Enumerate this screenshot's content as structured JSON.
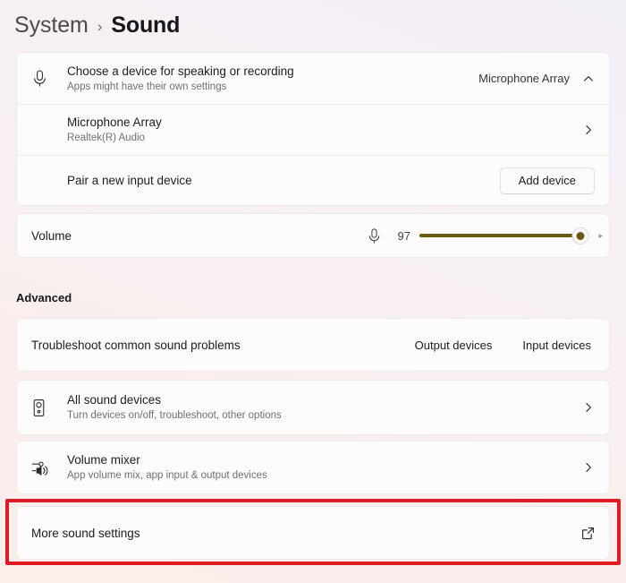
{
  "breadcrumb": {
    "parent": "System",
    "separator": "›",
    "current": "Sound"
  },
  "input_device_card": {
    "chooser": {
      "icon": "microphone-icon",
      "title": "Choose a device for speaking or recording",
      "subtitle": "Apps might have their own settings",
      "selected_device": "Microphone Array",
      "expand_icon": "chevron-up-icon"
    },
    "device": {
      "title": "Microphone Array",
      "subtitle": "Realtek(R) Audio",
      "chevron_icon": "chevron-right-icon"
    },
    "pair": {
      "title": "Pair a new input device",
      "button_label": "Add device"
    }
  },
  "volume_card": {
    "label": "Volume",
    "icon": "microphone-icon",
    "value": "97",
    "percent": 97,
    "accent_color": "#6b5a14"
  },
  "advanced": {
    "heading": "Advanced",
    "troubleshoot": {
      "title": "Troubleshoot common sound problems",
      "links": [
        "Output devices",
        "Input devices"
      ]
    },
    "all_sound_devices": {
      "icon": "speaker-device-icon",
      "title": "All sound devices",
      "subtitle": "Turn devices on/off, troubleshoot, other options",
      "chevron_icon": "chevron-right-icon"
    },
    "volume_mixer": {
      "icon": "volume-mixer-icon",
      "title": "Volume mixer",
      "subtitle": "App volume mix, app input & output devices",
      "chevron_icon": "chevron-right-icon"
    },
    "more_sound_settings": {
      "title": "More sound settings",
      "icon": "external-link-icon",
      "highlight_color": "#e01b23"
    }
  }
}
